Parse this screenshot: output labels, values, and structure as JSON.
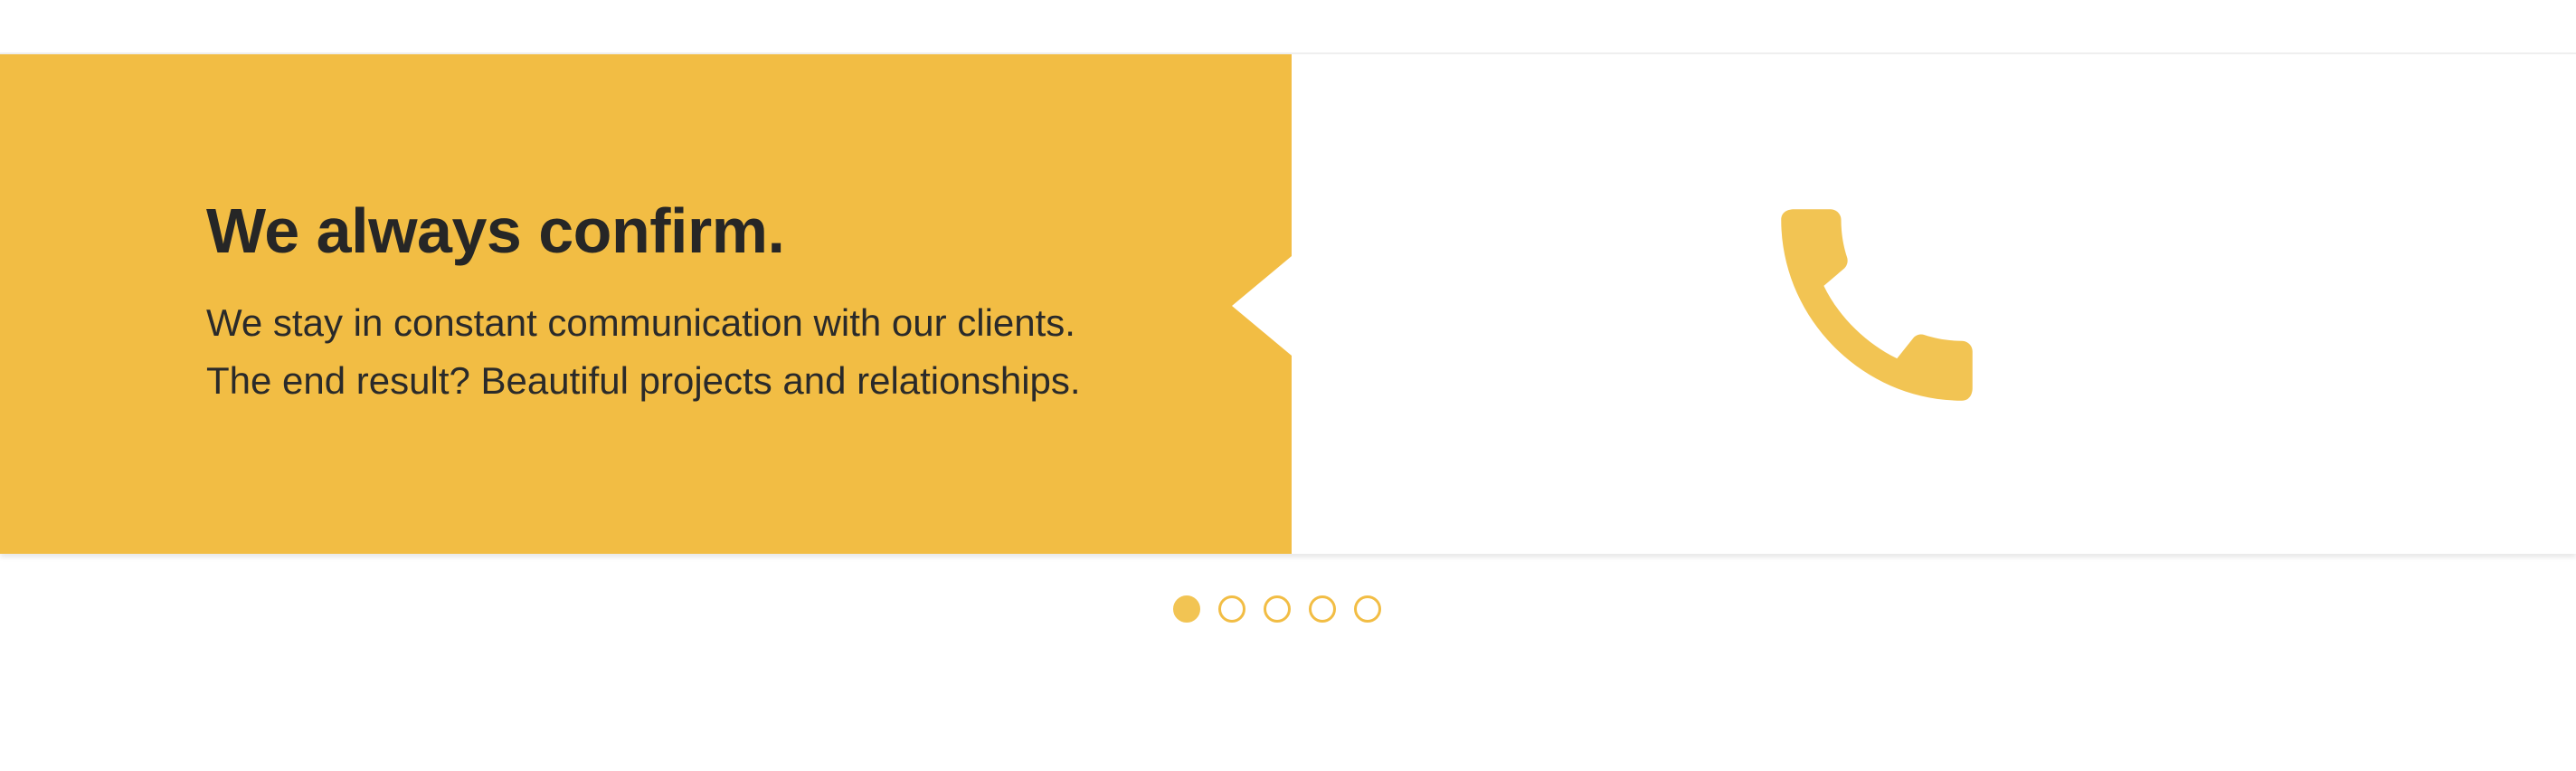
{
  "slide": {
    "title": "We always confirm.",
    "description_lines": [
      "We stay in constant communication with our clients.",
      "The end result? Beautiful projects and relationships."
    ],
    "icon": "phone-icon"
  },
  "pagination": {
    "count": 5,
    "active_index": 0
  },
  "colors": {
    "accent": "#f2bd44",
    "text_dark": "#262626",
    "background": "#ffffff"
  }
}
